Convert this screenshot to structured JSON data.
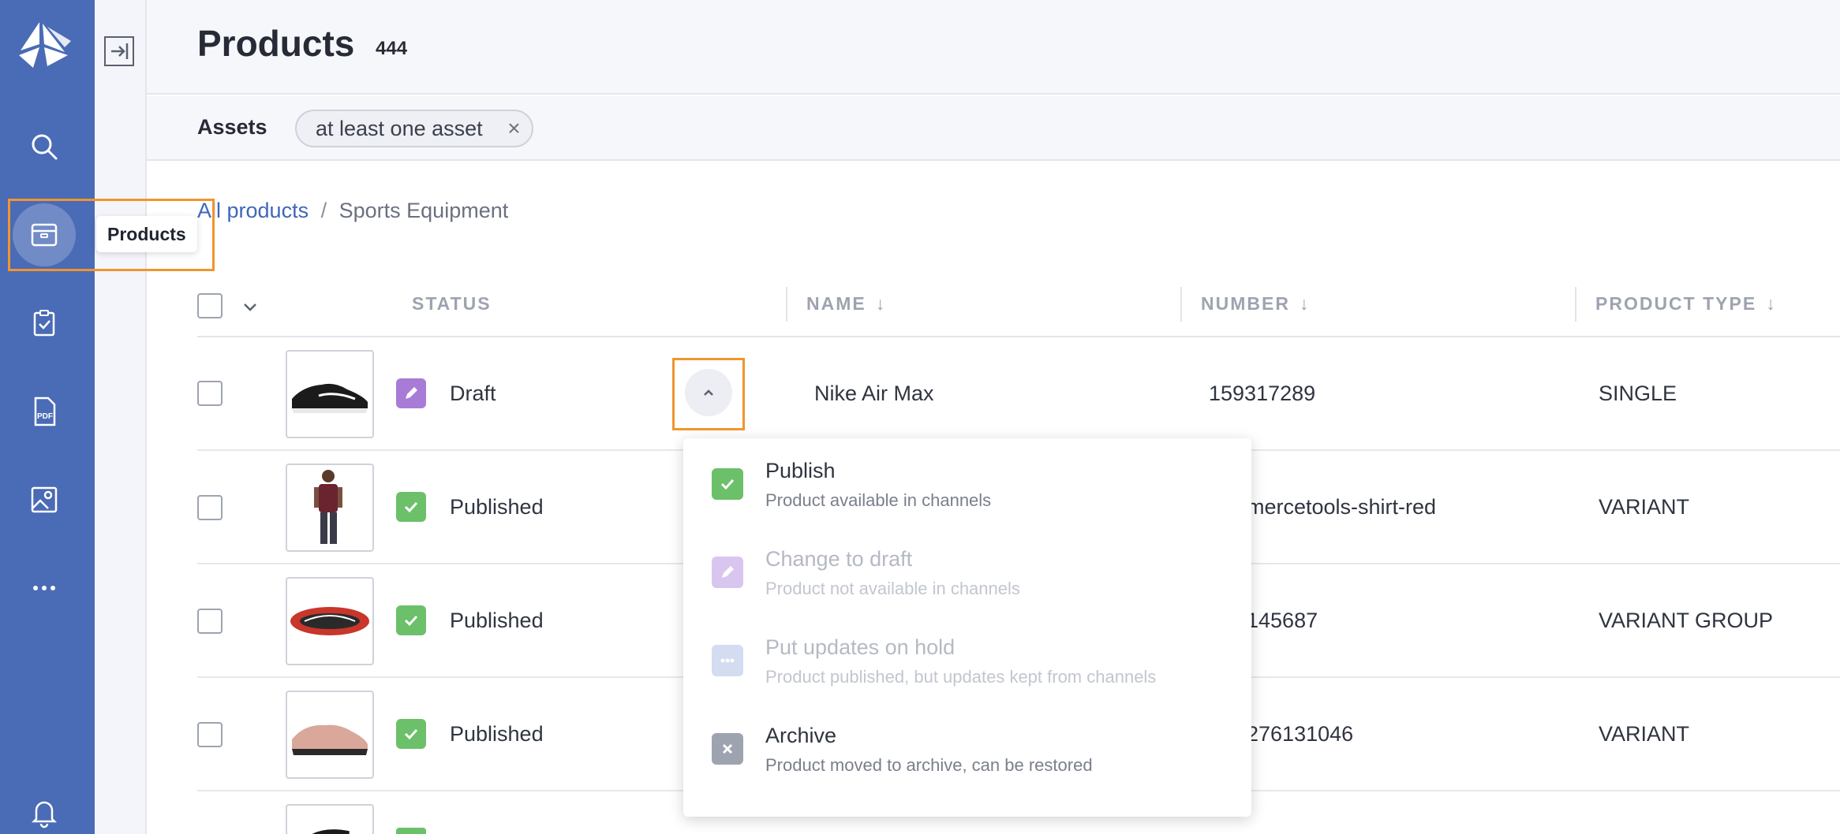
{
  "header": {
    "title": "Products",
    "count": "444"
  },
  "filter": {
    "label": "Assets",
    "chip": "at least one asset",
    "chip_remove": "×"
  },
  "breadcrumb": {
    "root": "All products",
    "separator": "/",
    "current": "Sports Equipment"
  },
  "tooltip": {
    "text": "Products"
  },
  "table": {
    "columns": {
      "status": "STATUS",
      "name": "NAME",
      "number": "NUMBER",
      "product_type": "PRODUCT TYPE"
    },
    "sort_arrow": "↓",
    "rows": [
      {
        "status": "Draft",
        "status_color": "#a77bd6",
        "name": "Nike Air Max",
        "number": "159317289",
        "product_type": "SINGLE"
      },
      {
        "status": "Published",
        "status_color": "#6cc06a",
        "name": "",
        "number": "mercetools-shirt-red",
        "product_type": "VARIANT"
      },
      {
        "status": "Published",
        "status_color": "#6cc06a",
        "name": "",
        "number": "145687",
        "product_type": "VARIANT GROUP"
      },
      {
        "status": "Published",
        "status_color": "#6cc06a",
        "name": "",
        "number": "276131046",
        "product_type": "VARIANT"
      }
    ]
  },
  "menu": {
    "items": [
      {
        "title": "Publish",
        "desc": "Product available in channels",
        "color": "#6cc06a",
        "enabled": true
      },
      {
        "title": "Change to draft",
        "desc": "Product not available in channels",
        "color": "#d9c6ef",
        "enabled": false
      },
      {
        "title": "Put updates on hold",
        "desc": "Product published, but updates kept from channels",
        "color": "#d4dcf2",
        "enabled": false
      },
      {
        "title": "Archive",
        "desc": "Product moved to archive, can be restored",
        "color": "#9ea3b0",
        "enabled": true
      }
    ]
  },
  "colors": {
    "rail": "#4a6bb6",
    "accent": "#f0952e",
    "link": "#3f67b8"
  },
  "icons": [
    "logo-icon",
    "search-icon",
    "products-icon",
    "tasks-icon",
    "pdf-icon",
    "image-icon",
    "more-icon",
    "bell-icon",
    "collapse-icon"
  ]
}
